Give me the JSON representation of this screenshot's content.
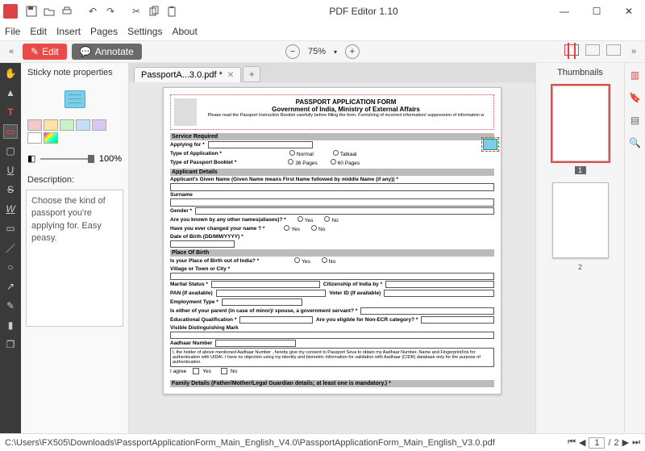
{
  "app": {
    "title": "PDF Editor 1.10"
  },
  "menu": {
    "file": "File",
    "edit": "Edit",
    "insert": "Insert",
    "pages": "Pages",
    "settings": "Settings",
    "about": "About"
  },
  "actions": {
    "edit": "Edit",
    "annotate": "Annotate",
    "zoom": "75%",
    "hide_left": "«",
    "hide_right": "»"
  },
  "tab": {
    "name": "PassportA...3.0.pdf *"
  },
  "props": {
    "title": "Sticky note properties",
    "opacity": "100%",
    "desc_label": "Description:",
    "description": "Choose the kind of passport you're applying for. Easy peasy.",
    "swatches": [
      "#f7c6c6",
      "#ffe3a3",
      "#c9f2c9",
      "#c4e0f7",
      "#d8c9f2",
      "#ffffff"
    ]
  },
  "thumbs": {
    "title": "Thumbnails",
    "p1": "1",
    "p2": "2"
  },
  "status": {
    "path": "C:\\Users\\FX505\\Downloads\\PassportApplicationForm_Main_English_V4.0\\PassportApplicationForm_Main_English_V3.0.pdf",
    "page": "1",
    "total": "2"
  },
  "form": {
    "title": "PASSPORT APPLICATION FORM",
    "subtitle": "Government of India, Ministry of External Affairs",
    "instr": "Please read the Passport Instruction Booklet carefully before filling the form. Furnishing of incorrect information/ suppression of information w",
    "sect_service": "Service Required",
    "applying_for": "Applying for *",
    "type_app": "Type of Application *",
    "normal": "Normal",
    "tatkaal": "Tatkaal",
    "type_booklet": "Type of Passport Booklet *",
    "p36": "36 Pages",
    "p60": "60 Pages",
    "sect_applicant": "Applicant Details",
    "given_name": "Applicant's Given Name (Given Name means First Name followed by middle Name (if any)) *",
    "surname": "Surname",
    "gender": "Gender *",
    "aliases": "Are you known by any other names(aliases)? *",
    "changed_name": "Have you ever changed your name ? *",
    "yes": "Yes",
    "no": "No",
    "dob": "Date of Birth (DD/MM/YYYY) *",
    "sect_pob": "Place Of Birth",
    "pob_out": "Is your Place of Birth out of India? *",
    "village": "Village or Town or City *",
    "marital": "Marital Status *",
    "citizenship": "Citizenship of India by *",
    "pan": "PAN (If available)",
    "voter": "Voter ID (If available)",
    "employment": "Employment Type *",
    "parent_gov": "Is either of your parent (in case of minor)/ spouse, a government servant? *",
    "edu": "Educational Qualification *",
    "non_ecr": "Are you eligible for Non-ECR category? *",
    "marks": "Visible Distinguishing Mark",
    "aadhaar": "Aadhaar Number",
    "consent": "I, the holder of above mentioned Aadhaar Number , hereby give my consent to Passport Seva to obtain my Aadhaar Number, Name and Fingerprint/Iris for authentication with UIDAI. I have no objection using my identity and biometric information for validation with Aadhaar (CIDR) database only for the purpose of authentication.",
    "agree": "I agree",
    "sect_family": "Family Details (Father/Mother/Legal Guardian details; at least one is mandatory.) *"
  }
}
